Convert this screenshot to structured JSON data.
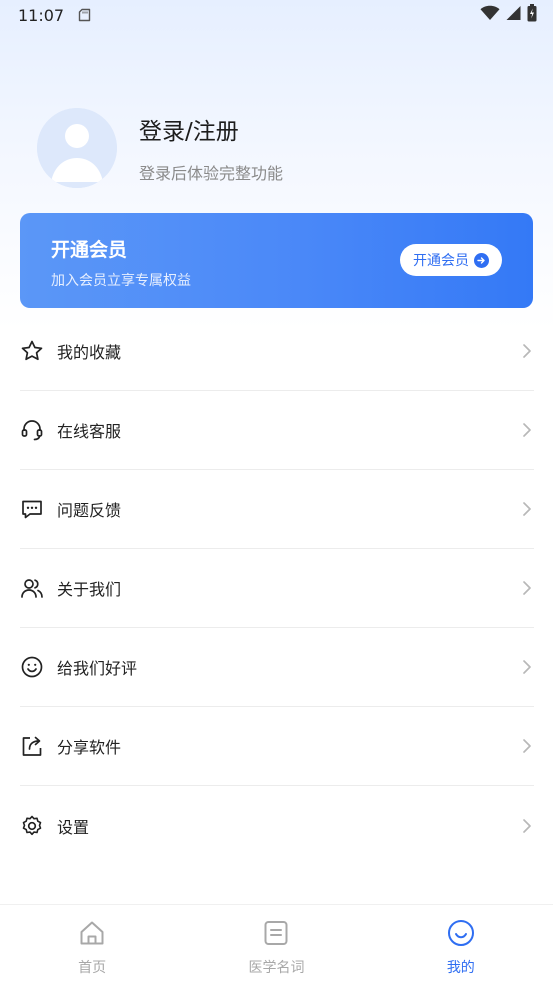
{
  "status_bar": {
    "time": "11:07"
  },
  "profile": {
    "title": "登录/注册",
    "subtitle": "登录后体验完整功能"
  },
  "vip_card": {
    "title": "开通会员",
    "subtitle": "加入会员立享专属权益",
    "button_label": "开通会员"
  },
  "menu": {
    "items": [
      {
        "label": "我的收藏",
        "icon": "star-icon"
      },
      {
        "label": "在线客服",
        "icon": "headset-icon"
      },
      {
        "label": "问题反馈",
        "icon": "chat-icon"
      },
      {
        "label": "关于我们",
        "icon": "users-icon"
      },
      {
        "label": "给我们好评",
        "icon": "smile-icon"
      },
      {
        "label": "分享软件",
        "icon": "share-icon"
      },
      {
        "label": "设置",
        "icon": "gear-icon"
      }
    ]
  },
  "tabbar": {
    "tabs": [
      {
        "label": "首页",
        "icon": "home-icon"
      },
      {
        "label": "医学名词",
        "icon": "document-icon"
      },
      {
        "label": "我的",
        "icon": "smile-face-icon"
      }
    ],
    "active": "我的"
  },
  "colors": {
    "accent": "#2f6ef2",
    "vip_gradient_start": "#5b97f7",
    "vip_gradient_end": "#3479f6",
    "inactive_tab": "#a8a8a8"
  }
}
